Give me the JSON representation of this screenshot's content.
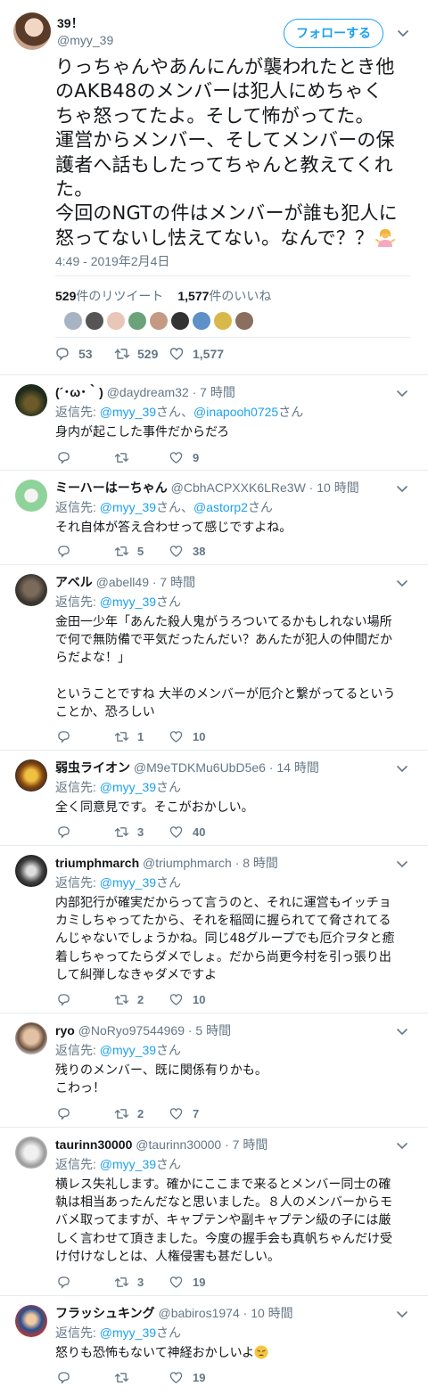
{
  "main_tweet": {
    "name": "39！",
    "handle": "@myy_39",
    "follow_label": "フォローする",
    "text_lines": [
      "りっちゃんやあんにんが襲われたとき他",
      "のAKB48のメンバーは犯人にめちゃく",
      "ちゃ怒ってたよ。そして怖がってた。",
      "運営からメンバー、そしてメンバーの保",
      "護者へ話もしたってちゃんと教えてくれ",
      "た。",
      "今回のNGTの件はメンバーが誰も犯人に",
      "怒ってないし怯えてない。なんで？？"
    ],
    "emoji": "woman-shrugging-emoji",
    "date": "4:49 - 2019年2月4日",
    "retweets_count": "529",
    "retweets_label": "件のリツイート",
    "likes_count": "1,577",
    "likes_label": "件のいいね",
    "reply_count": "53",
    "retweet_count": "529",
    "like_count": "1,577"
  },
  "replies": [
    {
      "name": "(´･ω･｀)",
      "handle": "@daydream32 · 7 時間",
      "to_label": "返信先: ",
      "to_users": [
        "@myy_39",
        "@inapooh0725"
      ],
      "to_suffix": "さん",
      "to_sep": "さん、",
      "body": [
        "身内が起こした事件だからだろ"
      ],
      "retweets": "",
      "likes": "9",
      "avatar_color": "#3a2f1f"
    },
    {
      "name": "ミーハーはーちゃん",
      "handle": "@CbhACPXXK6LRe3W · 10 時間",
      "to_label": "返信先: ",
      "to_users": [
        "@myy_39",
        "@astorp2"
      ],
      "to_suffix": "さん",
      "to_sep": "さん、",
      "body": [
        "それ自体が答え合わせって感じですよね。"
      ],
      "retweets": "5",
      "likes": "38",
      "avatar_color": "#8fd39a"
    },
    {
      "name": "アベル",
      "handle": "@abell49 · 7 時間",
      "to_label": "返信先: ",
      "to_users": [
        "@myy_39"
      ],
      "to_suffix": "さん",
      "to_sep": "",
      "body": [
        "金田一少年「あんた殺人鬼がうろついてるかもしれない場所",
        "で何で無防備で平気だったんだい？あんたが犯人の仲間だか",
        "らだよな！」",
        "",
        "ということですね 大半のメンバーが厄介と繋がってるという",
        "ことか、恐ろしい"
      ],
      "retweets": "1",
      "likes": "10",
      "avatar_color": "#5a4a3c"
    },
    {
      "name": "弱虫ライオン",
      "handle": "@M9eTDKMu6UbD5e6 · 14 時間",
      "to_label": "返信先: ",
      "to_users": [
        "@myy_39"
      ],
      "to_suffix": "さん",
      "to_sep": "",
      "body": [
        "全く同意見です。そこがおかしい。"
      ],
      "retweets": "3",
      "likes": "40",
      "avatar_color": "#e0a22a"
    },
    {
      "name": "triumphmarch",
      "handle": "@triumphmarch · 8 時間",
      "to_label": "返信先: ",
      "to_users": [
        "@myy_39"
      ],
      "to_suffix": "さん",
      "to_sep": "",
      "body": [
        "内部犯行が確実だからって言うのと、それに運営もイッチョ",
        "カミしちゃってたから、それを稲岡に握られてて脅されてる",
        "んじゃないでしょうかね。同じ48グループでも厄介ヲタと癒",
        "着しちゃってたらダメでしょ。だから尚更今村を引っ張り出",
        "して糾弾しなきゃダメですよ"
      ],
      "retweets": "2",
      "likes": "10",
      "avatar_color": "#2b2b2b"
    },
    {
      "name": "ryo",
      "handle": "@NoRyo97544969 · 5 時間",
      "to_label": "返信先: ",
      "to_users": [
        "@myy_39"
      ],
      "to_suffix": "さん",
      "to_sep": "",
      "body": [
        "残りのメンバー、既に関係有りかも。",
        "こわっ！"
      ],
      "retweets": "2",
      "likes": "7",
      "avatar_color": "#b08a6a"
    },
    {
      "name": "taurinn30000",
      "handle": "@taurinn30000 · 7 時間",
      "to_label": "返信先: ",
      "to_users": [
        "@myy_39"
      ],
      "to_suffix": "さん",
      "to_sep": "",
      "body": [
        "横レス失礼します。確かにここまで来るとメンバー同士の確",
        "執は相当あったんだなと思いました。８人のメンバーからモ",
        "バメ取ってますが、キャプテンや副キャプテン級の子には厳",
        "しく言わせて頂きました。今度の握手会も真帆ちゃんだけ受",
        "け付けなしとは、人権侵害も甚だしい。"
      ],
      "retweets": "3",
      "likes": "19",
      "avatar_color": "#b9b9b9"
    },
    {
      "name": "フラッシュキング",
      "handle": "@babiros1974 · 10 時間",
      "to_label": "返信先: ",
      "to_users": [
        "@myy_39"
      ],
      "to_suffix": "さん",
      "to_sep": "",
      "body": [
        "怒りも恐怖もないて神経おかしいよ"
      ],
      "body_emoji": "weary-face-emoji",
      "retweets": "",
      "likes": "19",
      "avatar_color": "#2a4f8f"
    }
  ]
}
